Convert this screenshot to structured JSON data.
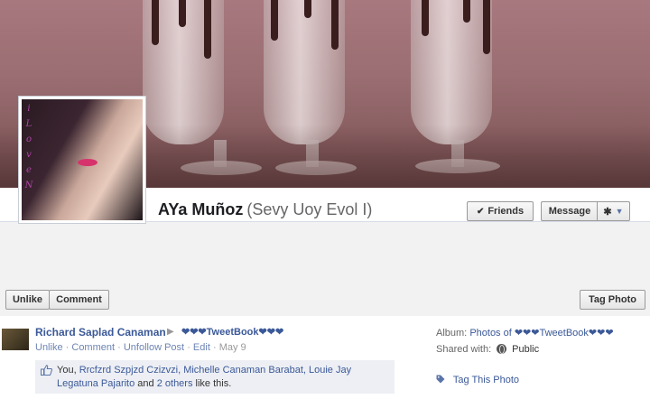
{
  "cover": {
    "description_icon": "cover-photo"
  },
  "profile": {
    "name": "AYa Muñoz",
    "alt_name": "(Sevy Uoy Evol I)",
    "picture_text": [
      "i",
      "L",
      "o",
      "v",
      "e",
      "N"
    ]
  },
  "header_actions": {
    "friends_label": "Friends",
    "message_label": "Message",
    "gear_icon": "gear-icon"
  },
  "photo_actions": {
    "unlike_label": "Unlike",
    "comment_label": "Comment",
    "tag_photo_label": "Tag Photo"
  },
  "post": {
    "poster": "Richard Saplad Canaman",
    "target": "❤❤❤TweetBook❤❤❤",
    "actions": {
      "unlike": "Unlike",
      "comment": "Comment",
      "unfollow": "Unfollow Post",
      "edit": "Edit",
      "date": "May 9"
    },
    "likes": {
      "you": "You,",
      "names": "Rrcfzrd Szpjzd Czizvzi, Michelle Canaman Barabat, Louie Jay Legatuna Pajarito",
      "and": "and",
      "others": "2 others",
      "suffix": "like this."
    }
  },
  "sidebar": {
    "album_label": "Album:",
    "album_value": "Photos of ❤❤❤TweetBook❤❤❤",
    "shared_label": "Shared with:",
    "shared_value": "Public",
    "tag_this_photo": "Tag This Photo"
  },
  "colors": {
    "link": "#3b5998",
    "likes_bg": "#edeff4",
    "page_bg": "#f2f2f2"
  }
}
